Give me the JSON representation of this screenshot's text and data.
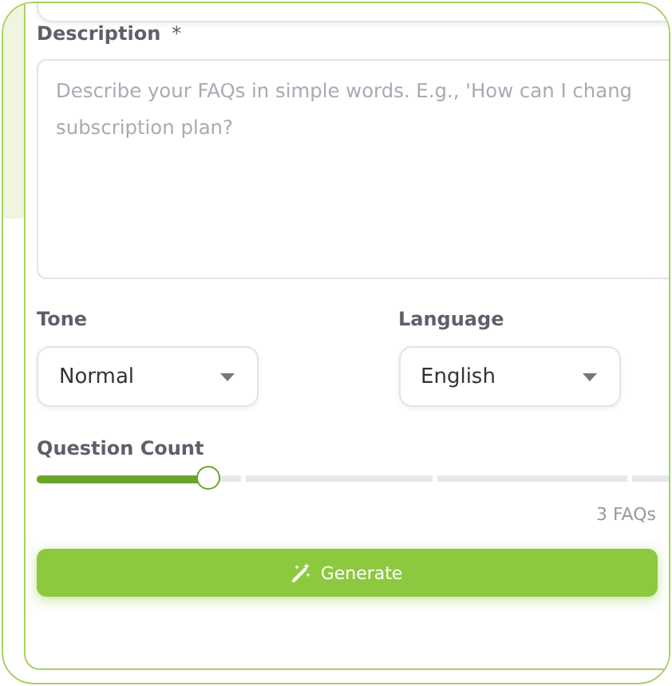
{
  "description": {
    "label": "Description",
    "required_mark": "*",
    "placeholder": "Describe your FAQs in simple words. E.g., 'How can I chang\nsubscription plan?"
  },
  "tone": {
    "label": "Tone",
    "value": "Normal"
  },
  "language": {
    "label": "Language",
    "value": "English"
  },
  "question_count": {
    "label": "Question Count",
    "level": 0.27,
    "reading": "3 FAQs"
  },
  "buttons": [
    {
      "label": "Generate"
    }
  ]
}
